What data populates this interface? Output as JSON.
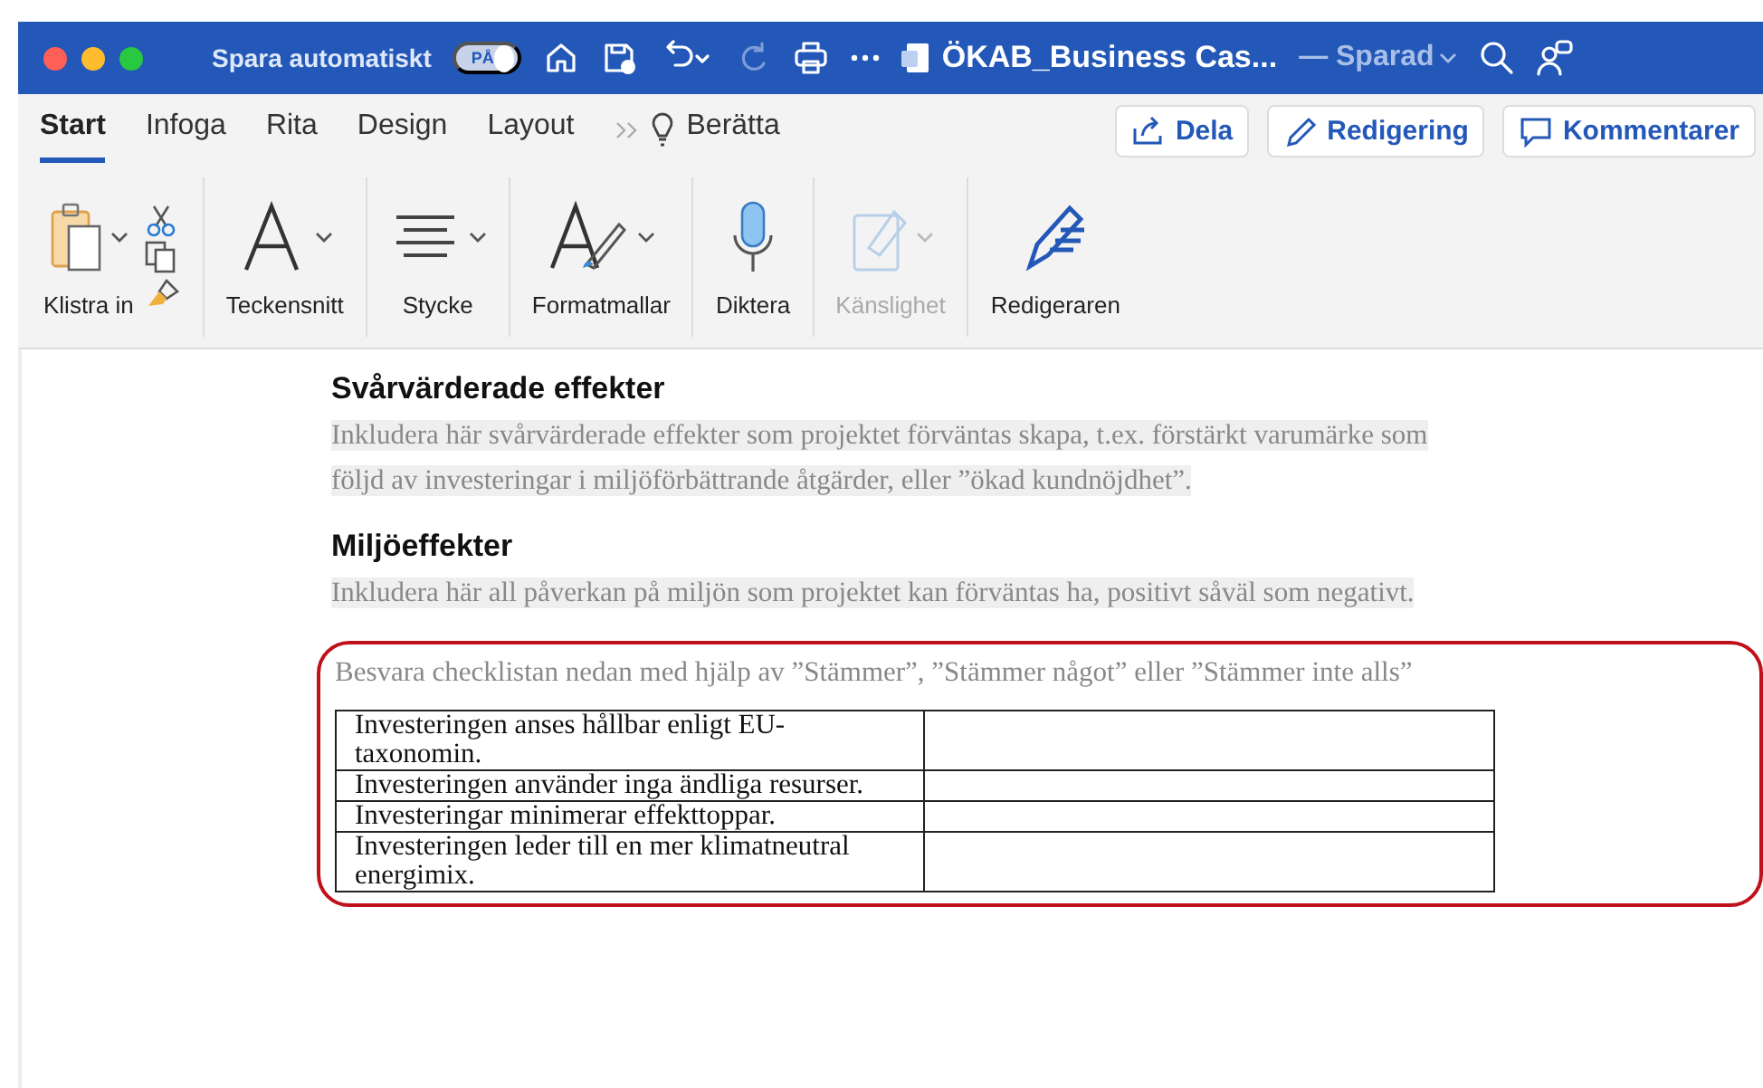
{
  "title_bar": {
    "autosave_label": "Spara automatiskt",
    "autosave": {
      "label": "PÅ",
      "on": true
    },
    "document_title": "ÖKAB_Business Cas...",
    "save_status": "— Sparad"
  },
  "tabs": [
    {
      "label": "Start",
      "selected": true
    },
    {
      "label": "Infoga",
      "selected": false
    },
    {
      "label": "Rita",
      "selected": false
    },
    {
      "label": "Design",
      "selected": false
    },
    {
      "label": "Layout",
      "selected": false
    }
  ],
  "tell_me": "Berätta",
  "actions": [
    {
      "kind": "share",
      "label": "Dela"
    },
    {
      "kind": "edit",
      "label": "Redigering"
    },
    {
      "kind": "comment",
      "label": "Kommentarer"
    }
  ],
  "ribbon": [
    {
      "kind": "paste",
      "label": "Klistra in",
      "disabled": false
    },
    {
      "kind": "font",
      "label": "Teckensnitt",
      "disabled": false
    },
    {
      "kind": "paragraph",
      "label": "Stycke",
      "disabled": false
    },
    {
      "kind": "styles",
      "label": "Formatmallar",
      "disabled": false
    },
    {
      "kind": "dictate",
      "label": "Diktera",
      "disabled": false
    },
    {
      "kind": "sensitivity",
      "label": "Känslighet",
      "disabled": true
    },
    {
      "kind": "editor",
      "label": "Redigeraren",
      "disabled": false
    }
  ],
  "document": {
    "sections": [
      {
        "heading": "Svårvärderade effekter",
        "body": "Inkludera här svårvärderade effekter som projektet förväntas skapa, t.ex. förstärkt varumärke som följd av investeringar i miljöförbättrande åtgärder, eller ”ökad kundnöjdhet”."
      },
      {
        "heading": "Miljöeffekter",
        "body": "Inkludera här all påverkan på miljön som projektet kan förväntas ha, positivt såväl som negativt."
      }
    ],
    "checklist": {
      "instruction": "Besvara checklistan nedan med hjälp av ”Stämmer”, ”Stämmer något” eller ”Stämmer inte alls”",
      "rows": [
        {
          "statement": "Investeringen anses hållbar enligt EU-taxonomin."
        },
        {
          "statement": "Investeringen använder inga ändliga resurser."
        },
        {
          "statement": "Investeringar minimerar effekttoppar."
        },
        {
          "statement": "Investeringen leder till en mer klimatneutral energimix."
        }
      ]
    }
  }
}
